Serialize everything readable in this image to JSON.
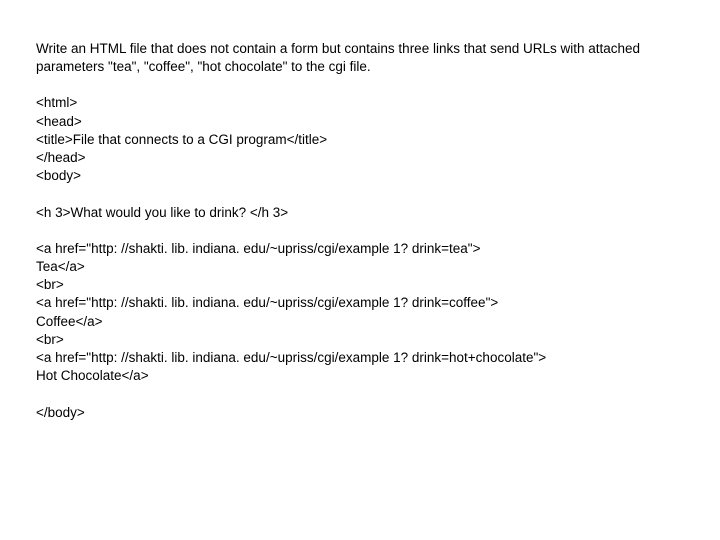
{
  "intro": "Write an HTML file that does not contain a form but contains three links that send URLs with attached parameters \"tea\", \"coffee\", \"hot chocolate\" to the cgi file.",
  "block1": "<html>\n<head>\n<title>File that connects to a CGI program</title>\n</head>\n<body>",
  "block2": "<h 3>What would you like to drink? </h 3>",
  "block3": "<a href=\"http: //shakti. lib. indiana. edu/~upriss/cgi/example 1? drink=tea\">\nTea</a>\n<br>\n<a href=\"http: //shakti. lib. indiana. edu/~upriss/cgi/example 1? drink=coffee\">\nCoffee</a>\n<br>\n<a href=\"http: //shakti. lib. indiana. edu/~upriss/cgi/example 1? drink=hot+chocolate\">\nHot Chocolate</a>",
  "block4": "</body>"
}
